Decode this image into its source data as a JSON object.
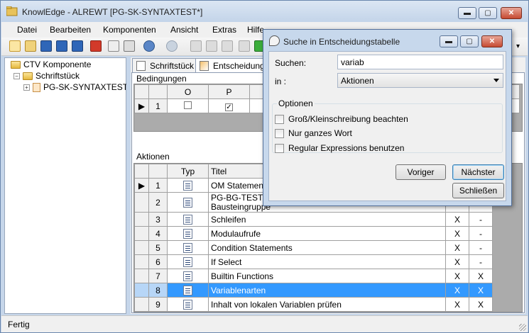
{
  "window": {
    "title": "KnowlEdge - ALREWT [PG-SK-SYNTAXTEST*]",
    "minimize": "▬",
    "maximize": "▢",
    "close": "✕"
  },
  "menu": {
    "items": [
      "Datei",
      "Bearbeiten",
      "Komponenten",
      "Ansicht",
      "Extras",
      "Hilfe"
    ]
  },
  "tree": {
    "root": "CTV Komponente",
    "child": "Schriftstück",
    "leaf": "PG-SK-SYNTAXTEST"
  },
  "tabs": [
    {
      "label": "Schriftstück"
    },
    {
      "label": "Entscheidungst"
    }
  ],
  "conditions": {
    "title": "Bedingungen",
    "columns": [
      "O",
      "P"
    ],
    "rows": [
      {
        "num": "1",
        "o": false,
        "p": true
      }
    ]
  },
  "actions": {
    "title": "Aktionen",
    "columns": {
      "typ": "Typ",
      "titel": "Titel"
    },
    "rows": [
      {
        "num": "1",
        "title": "OM Statements",
        "c1": "",
        "c2": ""
      },
      {
        "num": "2",
        "title": "PG-BG-TESTCA\nBausteingruppe",
        "c1": "",
        "c2": "",
        "doc": true
      },
      {
        "num": "3",
        "title": "Schleifen",
        "c1": "X",
        "c2": "-"
      },
      {
        "num": "4",
        "title": "Modulaufrufe",
        "c1": "X",
        "c2": "-"
      },
      {
        "num": "5",
        "title": "Condition Statements",
        "c1": "X",
        "c2": "-"
      },
      {
        "num": "6",
        "title": "If Select",
        "c1": "X",
        "c2": "-"
      },
      {
        "num": "7",
        "title": "Builtin Functions",
        "c1": "X",
        "c2": "X"
      },
      {
        "num": "8",
        "title": "Variablenarten",
        "c1": "X",
        "c2": "X",
        "selected": true
      },
      {
        "num": "9",
        "title": "Inhalt von lokalen Variablen prüfen",
        "c1": "X",
        "c2": "X"
      }
    ]
  },
  "status": {
    "text": "Fertig"
  },
  "dialog": {
    "title": "Suche in Entscheidungstabelle",
    "search_label": "Suchen:",
    "search_value": "variab",
    "in_label": "in :",
    "in_value": "Aktionen",
    "options_title": "Optionen",
    "opt_case": "Groß/Kleinschreibung beachten",
    "opt_word": "Nur ganzes Wort",
    "opt_regex": "Regular Expressions benutzen",
    "btn_prev": "Voriger",
    "btn_next": "Nächster",
    "btn_close": "Schließen"
  },
  "colors": {
    "selection": "#3399ff",
    "frame": "#c6d6ea"
  }
}
